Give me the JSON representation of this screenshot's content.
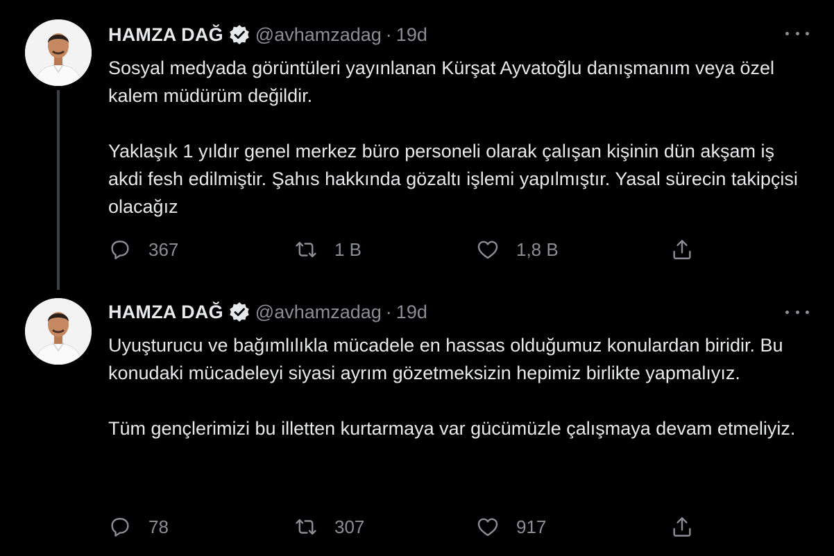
{
  "tweets": [
    {
      "author_name": "HAMZA DAĞ",
      "handle": "@avhamzadag",
      "separator": "·",
      "time": "19d",
      "paragraphs": [
        "Sosyal medyada görüntüleri yayınlanan Kürşat Ayvatoğlu danışmanım veya özel kalem müdürüm değildir.",
        "Yaklaşık 1 yıldır genel merkez büro personeli olarak çalışan kişinin dün akşam iş akdi fesh edilmiştir. Şahıs hakkında gözaltı işlemi yapılmıştır. Yasal sürecin takipçisi olacağız"
      ],
      "replies": "367",
      "retweets": "1 B",
      "likes": "1,8 B"
    },
    {
      "author_name": "HAMZA DAĞ",
      "handle": "@avhamzadag",
      "separator": "·",
      "time": "19d",
      "paragraphs": [
        "Uyuşturucu ve bağımlılıkla mücadele en hassas olduğumuz konulardan biridir. Bu konudaki mücadeleyi siyasi ayrım gözetmeksizin hepimiz birlikte yapmalıyız.",
        "Tüm gençlerimizi bu illetten kurtarmaya var gücümüzle çalışmaya devam etmeliyiz."
      ],
      "replies": "78",
      "retweets": "307",
      "likes": "917"
    }
  ],
  "icons": [
    "verified-badge-icon",
    "more-icon",
    "reply-icon",
    "retweet-icon",
    "like-icon",
    "share-icon"
  ],
  "colors": {
    "background": "#000000",
    "text": "#e7e9ea",
    "muted": "#8b8f94",
    "thread_line": "#3d4145"
  }
}
